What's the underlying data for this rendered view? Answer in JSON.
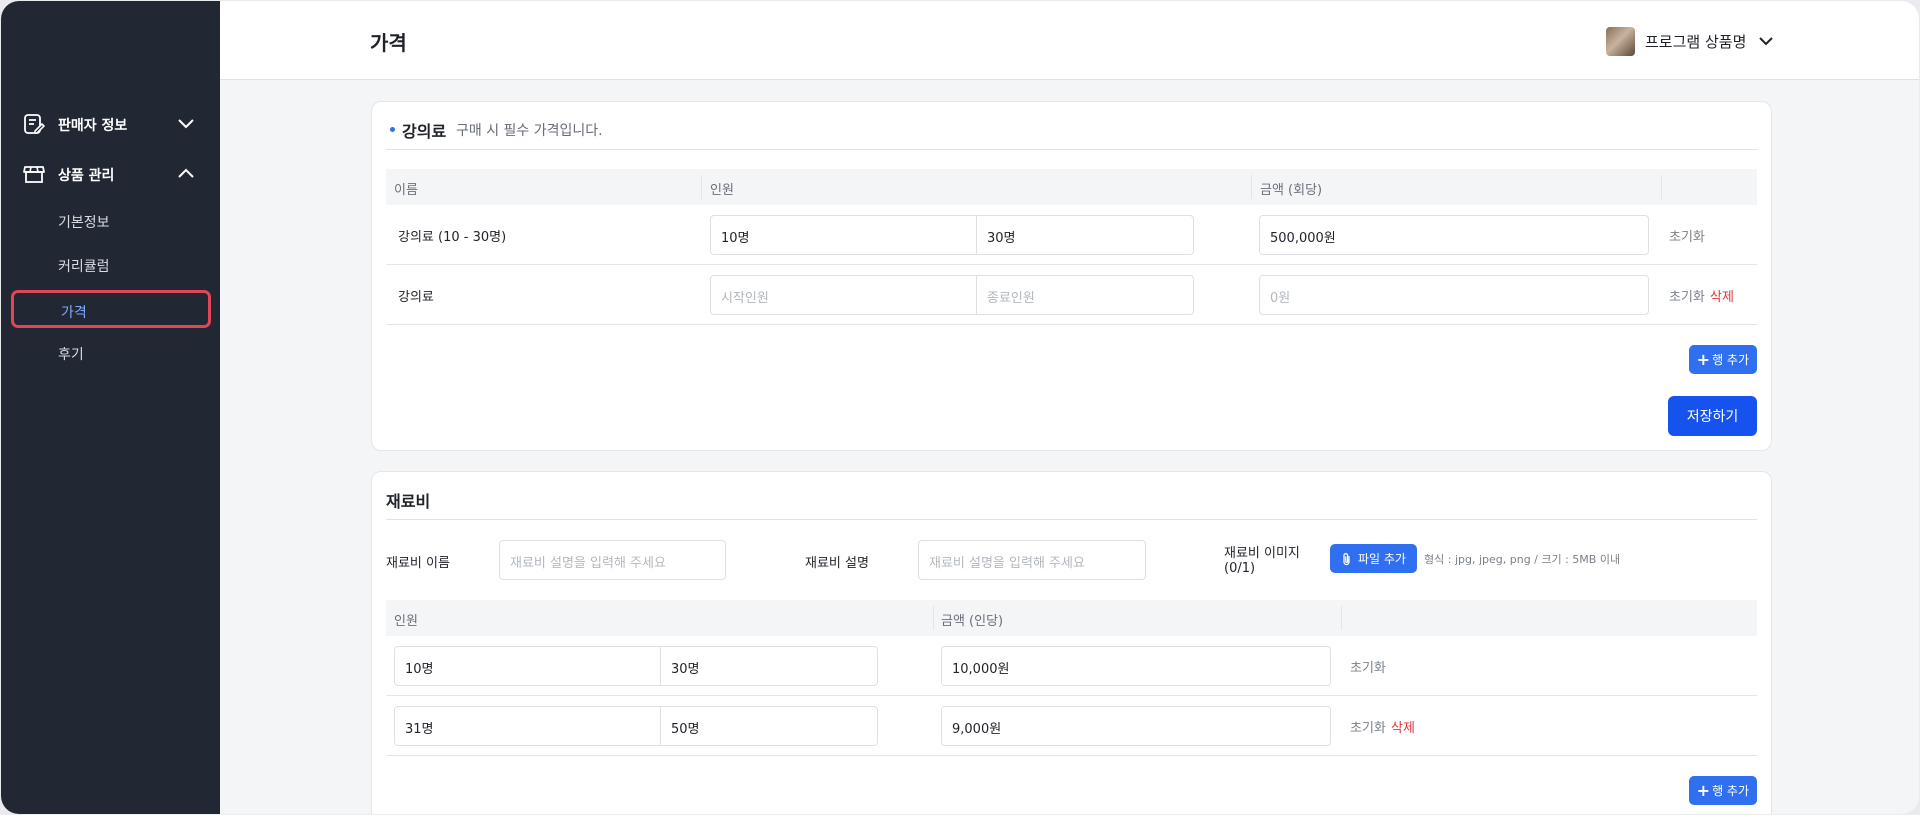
{
  "sidebar": {
    "groups": [
      {
        "label": "판매자 정보",
        "icon": "document-edit-icon",
        "expanded": false
      },
      {
        "label": "상품 관리",
        "icon": "store-icon",
        "expanded": true
      }
    ],
    "items": [
      {
        "label": "기본정보",
        "active": false
      },
      {
        "label": "커리큘럼",
        "active": false
      },
      {
        "label": "가격",
        "active": true
      },
      {
        "label": "후기",
        "active": false
      }
    ]
  },
  "header": {
    "title": "가격",
    "product_name": "프로그램 상품명"
  },
  "lecture_fee": {
    "title": "강의료",
    "subtitle": "구매 시 필수 가격입니다.",
    "columns": [
      "이름",
      "인원",
      "금액 (회당)"
    ],
    "rows": [
      {
        "name": "강의료 (10 - 30명)",
        "start": "10명",
        "end": "30명",
        "amount": "500,000원",
        "reset": "초기화"
      },
      {
        "name": "강의료",
        "start_placeholder": "시작인원",
        "end_placeholder": "종료인원",
        "amount_placeholder": "0원",
        "reset": "초기화",
        "delete": "삭제"
      }
    ],
    "add_row_label": "행 추가",
    "save_label": "저장하기"
  },
  "material_fee": {
    "title": "재료비",
    "name_label": "재료비 이름",
    "name_placeholder": "재료비 설명을 입력해 주세요",
    "desc_label": "재료비 설명",
    "desc_placeholder": "재료비 설명을 입력해 주세요",
    "image_label": "재료비 이미지",
    "image_count": "(0/1)",
    "file_button_label": "파일 추가",
    "file_hint": "형식 : jpg, jpeg, png / 크기 : 5MB 이내",
    "columns": [
      "인원",
      "금액 (인당)"
    ],
    "rows": [
      {
        "start": "10명",
        "end": "30명",
        "amount": "10,000원",
        "reset": "초기화"
      },
      {
        "start": "31명",
        "end": "50명",
        "amount": "9,000원",
        "reset": "초기화",
        "delete": "삭제"
      }
    ],
    "add_row_label": "행 추가"
  },
  "colors": {
    "sidebar_bg": "#222833",
    "accent": "#2f6ff0",
    "save_button": "#1652ee",
    "delete_text": "#e0353b",
    "highlight_border": "#e0465a"
  }
}
